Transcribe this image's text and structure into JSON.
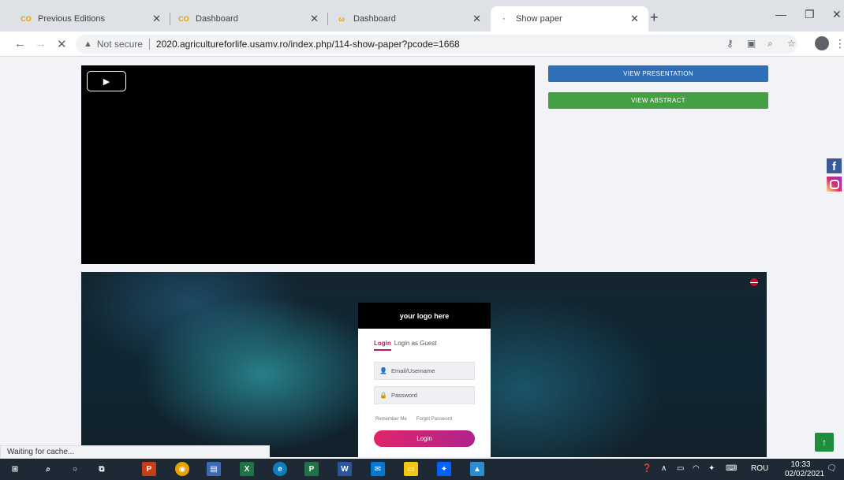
{
  "tabs": [
    {
      "title": "Previous Editions",
      "active": false
    },
    {
      "title": "Dashboard",
      "active": false
    },
    {
      "title": "Dashboard",
      "active": false
    },
    {
      "title": "Show paper",
      "active": true
    }
  ],
  "omnibox": {
    "security": "Not secure",
    "url": "2020.agricultureforlife.usamv.ro/index.php/114-show-paper?pcode=1668"
  },
  "page": {
    "view_presentation": "VIEW PRESENTATION",
    "view_abstract": "VIEW ABSTRACT",
    "login": {
      "logo": "your logo here",
      "tab_login": "Login",
      "tab_guest": "Login as Guest",
      "email_placeholder": "Email/Username",
      "password_placeholder": "Password",
      "remember": "Remember Me",
      "forgot": "Forgot Password",
      "button": "Login"
    }
  },
  "status": "Waiting for cache...",
  "taskbar": {
    "lang": "ROU",
    "time": "10:33",
    "date": "02/02/2021"
  },
  "colors": {
    "presentation_btn": "#2f6fb5",
    "abstract_btn": "#44a043",
    "login_accent": "#c2185b"
  }
}
